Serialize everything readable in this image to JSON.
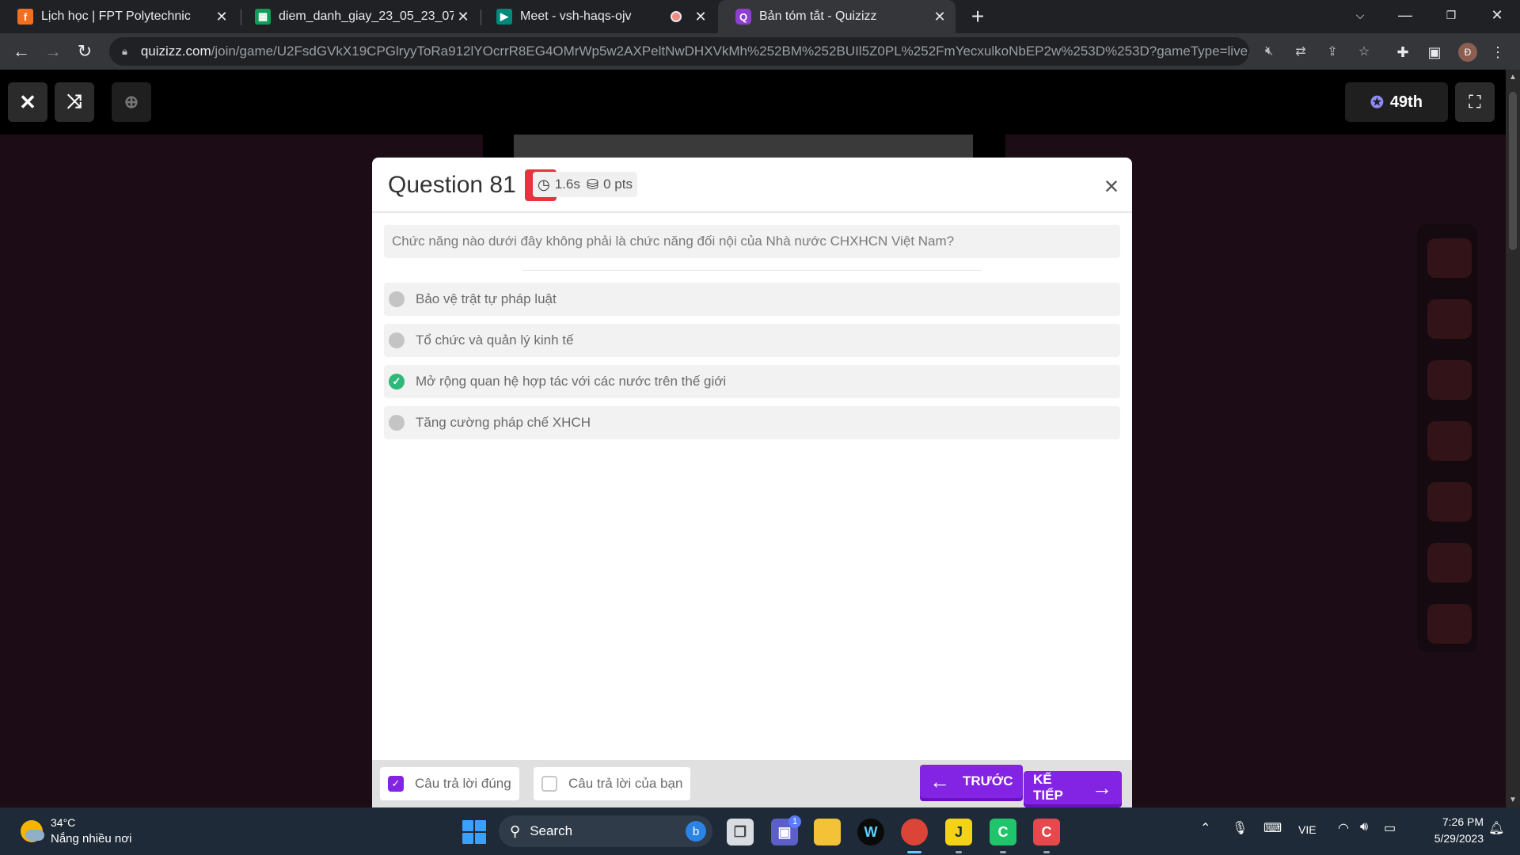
{
  "browser": {
    "tabs": [
      {
        "title": "Lịch học | FPT Polytechnic",
        "favicon": "fpt-logo-icon"
      },
      {
        "title": "diem_danh_giay_23_05_23_07_23",
        "favicon": "google-sheets-icon"
      },
      {
        "title": "Meet - vsh-haqs-ojv",
        "favicon": "google-meet-icon"
      },
      {
        "title": "Bản tóm tắt - Quizizz",
        "favicon": "quizizz-icon"
      }
    ],
    "url_host": "quizizz.com",
    "url_path": "/join/game/U2FsdGVkX19CPGlryyToRa912lYOcrrR8EG4OMrWp5w2AXPeltNwDHXVkMh%252BM%252BUIl5Z0PL%252FmYecxulkoNbEP2w%253D%253D?gameType=live...",
    "profile_initial": "Đ"
  },
  "game": {
    "rank": "49th"
  },
  "modal": {
    "question_label": "Question 81",
    "time": "1.6s",
    "points": "0 pts",
    "question_text": "Chức năng nào dưới đây không phải là chức năng đối nội của Nhà nước CHXHCN Việt Nam?",
    "options": [
      {
        "text": "Bảo vệ trật tự pháp luật",
        "correct": false
      },
      {
        "text": "Tổ chức và quản lý kinh tế",
        "correct": false
      },
      {
        "text": "Mở rộng quan hệ hợp tác với các nước trên thế giới",
        "correct": true
      },
      {
        "text": "Tăng cường pháp chế XHCH",
        "correct": false
      }
    ],
    "legend_correct": "Câu trả lời đúng",
    "legend_yours": "Câu trả lời của bạn",
    "prev_label": "TRƯỚC",
    "next_label": "KẾ TIẾP"
  },
  "taskbar": {
    "temperature": "34°C",
    "weather": "Nắng nhiều nơi",
    "search_label": "Search",
    "language": "VIE",
    "time": "7:26 PM",
    "date": "5/29/2023",
    "chat_badge": "1"
  },
  "colors": {
    "accent_purple": "#8323e3",
    "wrong_red": "#e5333f",
    "correct_green": "#2fb87a"
  }
}
